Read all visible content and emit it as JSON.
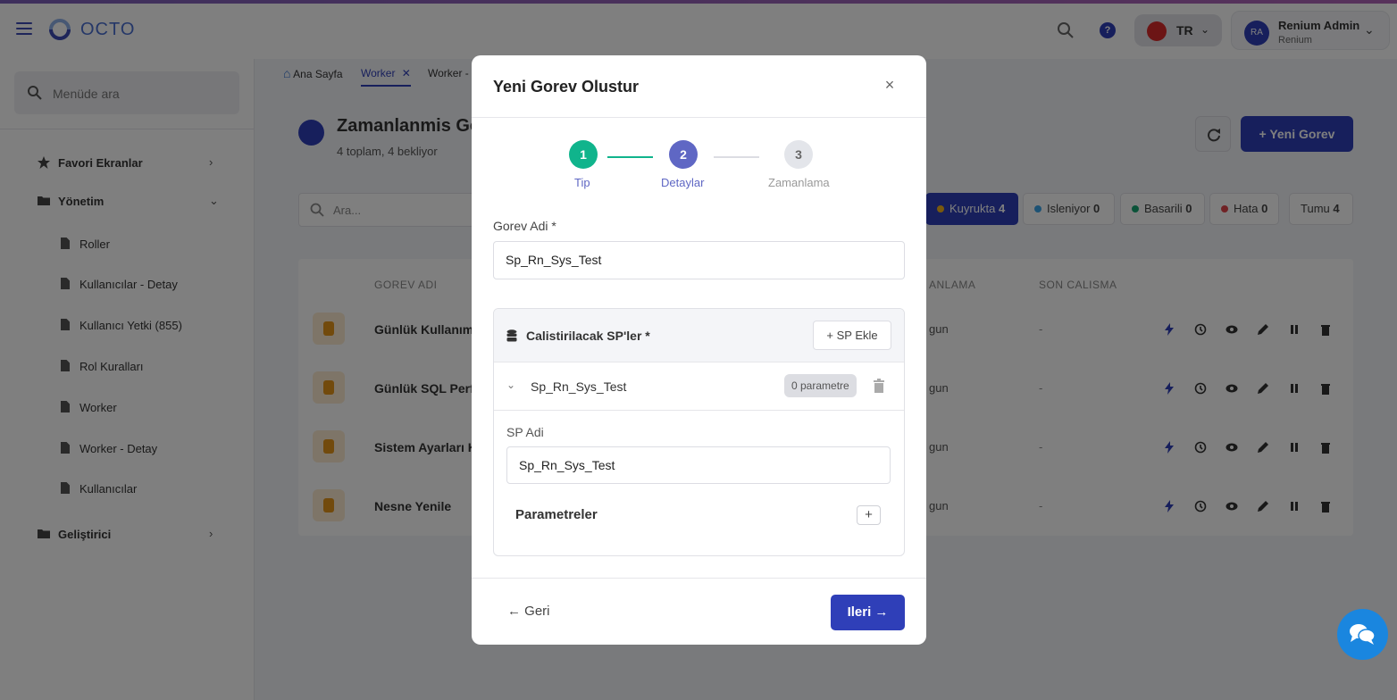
{
  "app": {
    "logo_text": "OCTO"
  },
  "header": {
    "language": "TR",
    "user_initials": "RA",
    "user_name": "Renium Admin",
    "user_org": "Renium",
    "help_label": "?"
  },
  "sidebar": {
    "search_placeholder": "Menüde ara",
    "groups": {
      "favorites": "Favori Ekranlar",
      "management": "Yönetim",
      "developer": "Geliştirici"
    },
    "items": [
      "Roller",
      "Kullanıcılar - Detay",
      "Kullanıcı Yetki (855)",
      "Rol Kuralları",
      "Worker",
      "Worker - Detay",
      "Kullanıcılar"
    ]
  },
  "tabs": {
    "home": "Ana Sayfa",
    "active": "Worker",
    "third": "Worker -"
  },
  "page": {
    "title": "Zamanlanmis Gorevler",
    "subtitle": "4 toplam, 4 bekliyor",
    "new_button": "Yeni Gorev",
    "search_placeholder": "Ara..."
  },
  "filters": [
    {
      "label": "Kuyrukta",
      "count": "4",
      "color": "#f5b21b",
      "active": true
    },
    {
      "label": "Isleniyor",
      "count": "0",
      "color": "#3ba4e8",
      "active": false
    },
    {
      "label": "Basarili",
      "count": "0",
      "color": "#17a673",
      "active": false
    },
    {
      "label": "Hata",
      "count": "0",
      "color": "#e0454b",
      "active": false
    },
    {
      "label": "Tumu",
      "count": "4",
      "color": "",
      "active": false
    }
  ],
  "table": {
    "headers": {
      "name": "GOREV ADI",
      "schedule": "ANLAMA",
      "last_run": "SON CALISMA"
    },
    "rows": [
      {
        "name": "Günlük Kullanım",
        "schedule": "gun",
        "last_run": "-"
      },
      {
        "name": "Günlük SQL Perfo",
        "schedule": "gun",
        "last_run": "-"
      },
      {
        "name": "Sistem Ayarları K",
        "schedule": "gun",
        "last_run": "-"
      },
      {
        "name": "Nesne Yenile",
        "schedule": "gun",
        "last_run": "-"
      }
    ]
  },
  "modal": {
    "title": "Yeni Gorev Olustur",
    "close": "×",
    "steps": [
      {
        "number": "1",
        "label": "Tip",
        "state": "done"
      },
      {
        "number": "2",
        "label": "Detaylar",
        "state": "current"
      },
      {
        "number": "3",
        "label": "Zamanlama",
        "state": "pending"
      }
    ],
    "task_name_label": "Gorev Adi *",
    "task_name_value": "Sp_Rn_Sys_Test",
    "sp_section_title": "Calistirilacak SP'ler *",
    "sp_add_label": "SP Ekle",
    "sp_item_name": "Sp_Rn_Sys_Test",
    "sp_param_badge": "0 parametre",
    "sp_name_label": "SP Adi",
    "sp_name_value": "Sp_Rn_Sys_Test",
    "params_title": "Parametreler",
    "params_add": "+",
    "back_label": "Geri",
    "next_label": "Ileri"
  },
  "colors": {
    "primary": "#2f3fb8",
    "step_done": "#10b48c",
    "step_current": "#5f67c4",
    "step_pending": "#e3e5ea",
    "orange": "#e49419"
  }
}
